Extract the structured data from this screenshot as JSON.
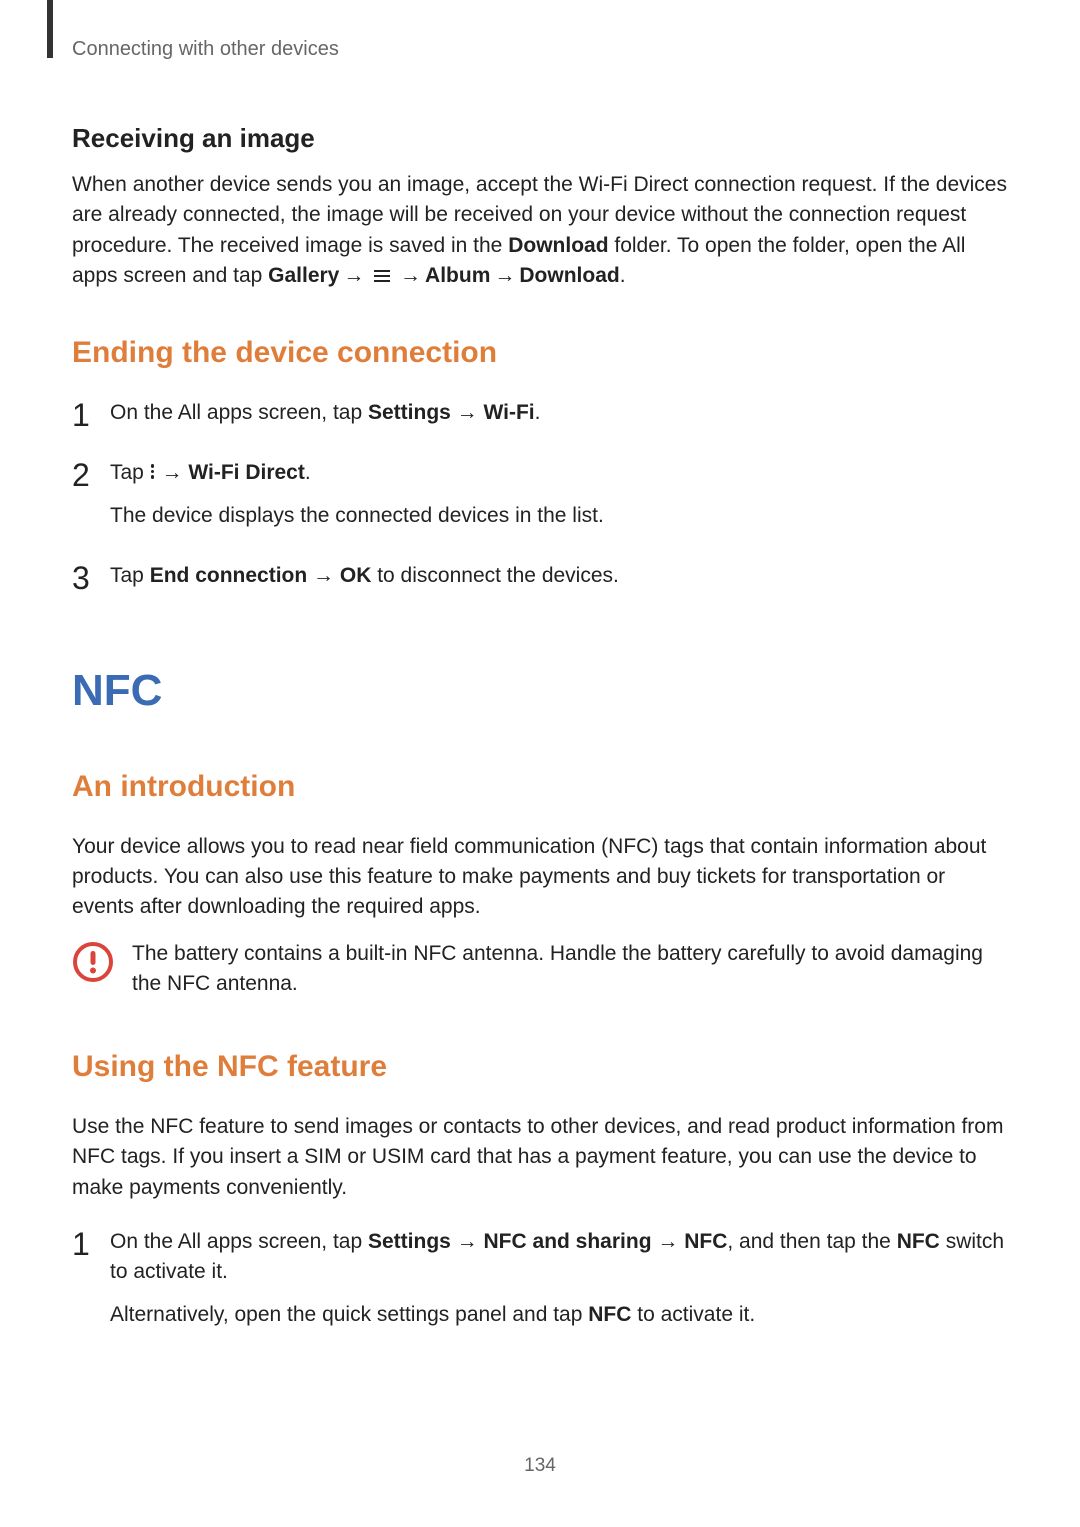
{
  "header": {
    "chapter": "Connecting with other devices"
  },
  "receiving": {
    "title": "Receiving an image",
    "para_pre": "When another device sends you an image, accept the Wi-Fi Direct connection request. If the devices are already connected, the image will be received on your device without the connection request procedure. The received image is saved in the ",
    "download_bold": "Download",
    "para_mid": " folder. To open the folder, open the All apps screen and tap ",
    "gallery": "Gallery",
    "arrow": "→",
    "album": "Album",
    "download2": "Download",
    "period": "."
  },
  "ending": {
    "title": "Ending the device connection",
    "step1_pre": "On the All apps screen, tap ",
    "step1_settings": "Settings",
    "step1_arrow": " → ",
    "step1_wifi": "Wi-Fi",
    "step1_period": ".",
    "step2_pre": "Tap ",
    "step2_arrow": " → ",
    "step2_direct": "Wi-Fi Direct",
    "step2_period": ".",
    "step2_sub": "The device displays the connected devices in the list.",
    "step3_pre": "Tap ",
    "step3_end": "End connection",
    "step3_arrow": " → ",
    "step3_ok": "OK",
    "step3_post": " to disconnect the devices."
  },
  "nfc": {
    "title": "NFC",
    "intro_title": "An introduction",
    "intro_text": "Your device allows you to read near field communication (NFC) tags that contain information about products. You can also use this feature to make payments and buy tickets for transportation or events after downloading the required apps.",
    "caution": "The battery contains a built-in NFC antenna. Handle the battery carefully to avoid damaging the NFC antenna.",
    "using_title": "Using the NFC feature",
    "using_text": "Use the NFC feature to send images or contacts to other devices, and read product information from NFC tags. If you insert a SIM or USIM card that has a payment feature, you can use the device to make payments conveniently.",
    "step1_pre": "On the All apps screen, tap ",
    "step1_settings": "Settings",
    "step1_arr": " → ",
    "step1_nfcshare": "NFC and sharing",
    "step1_nfc": "NFC",
    "step1_mid": ", and then tap the ",
    "step1_nfc2": "NFC",
    "step1_post": " switch to activate it.",
    "step1_alt_pre": "Alternatively, open the quick settings panel and tap ",
    "step1_alt_nfc": "NFC",
    "step1_alt_post": " to activate it."
  },
  "page_number": "134",
  "nums": {
    "n1": "1",
    "n2": "2",
    "n3": "3"
  }
}
